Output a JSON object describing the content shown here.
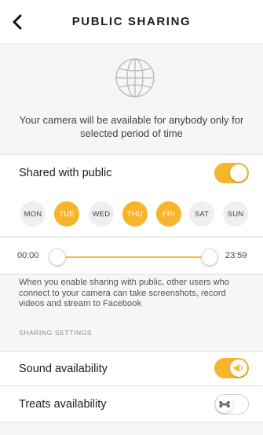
{
  "header": {
    "title": "PUBLIC SHARING",
    "back_icon": "chevron-left-icon"
  },
  "intro": {
    "icon": "globe-icon",
    "text": "Your camera will be available for anybody only for selected period of time"
  },
  "shared_public": {
    "label": "Shared with public",
    "enabled": true
  },
  "days": [
    {
      "label": "MON",
      "selected": false
    },
    {
      "label": "TUE",
      "selected": true
    },
    {
      "label": "WED",
      "selected": false
    },
    {
      "label": "THU",
      "selected": true
    },
    {
      "label": "FRI",
      "selected": true
    },
    {
      "label": "SAT",
      "selected": false
    },
    {
      "label": "SUN",
      "selected": false
    }
  ],
  "time_range": {
    "start": "00:00",
    "end": "23:59"
  },
  "note": "When you enable sharing with public, other users who connect to your camera can take screenshots, record videos and stream to Facebook",
  "sharing_settings": {
    "section_label": "SHARING SETTINGS",
    "sound": {
      "label": "Sound availability",
      "enabled": true,
      "icon": "speaker-icon"
    },
    "treats": {
      "label": "Treats availability",
      "enabled": false,
      "icon": "bone-icon"
    }
  },
  "colors": {
    "accent": "#f7b52b",
    "background": "#f6f6f6"
  }
}
